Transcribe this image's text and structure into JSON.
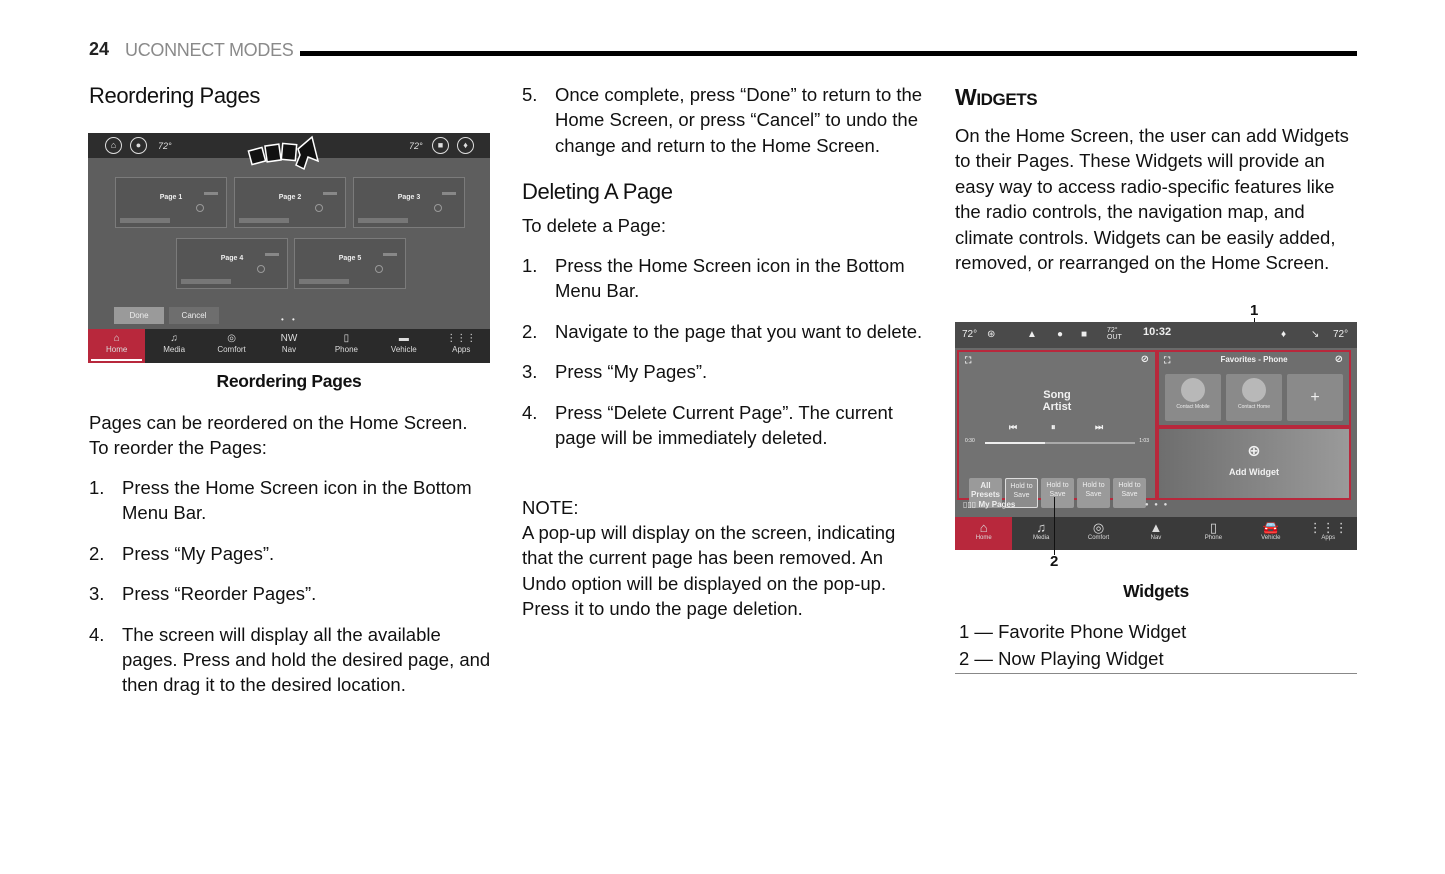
{
  "header": {
    "page_number": "24",
    "section_title": "UCONNECT MODES"
  },
  "left_column": {
    "heading": "Reordering Pages",
    "figure": {
      "caption": "Reordering Pages",
      "status_bar": {
        "temp_left": "72°",
        "temp_right": "72°"
      },
      "pages": [
        "Page 1",
        "Page 2",
        "Page 3",
        "Page 4",
        "Page 5"
      ],
      "buttons": {
        "done": "Done",
        "cancel": "Cancel"
      },
      "page_dots": "• •",
      "nav": [
        {
          "label": "Home",
          "icon": "⌂",
          "active": true
        },
        {
          "label": "Media",
          "icon": "♫",
          "active": false
        },
        {
          "label": "Comfort",
          "icon": "◎",
          "active": false
        },
        {
          "label": "Nav",
          "icon": "NW",
          "active": false
        },
        {
          "label": "Phone",
          "icon": "▯",
          "active": false
        },
        {
          "label": "Vehicle",
          "icon": "▬",
          "active": false
        },
        {
          "label": "Apps",
          "icon": "⋮⋮⋮",
          "active": false
        }
      ]
    },
    "intro": "Pages can be reordered on the Home Screen. To reorder the Pages:",
    "steps": [
      {
        "n": "1.",
        "text": "Press the Home Screen icon in the Bottom Menu Bar."
      },
      {
        "n": "2.",
        "text": "Press “My Pages”."
      },
      {
        "n": "3.",
        "text": "Press “Reorder Pages”."
      },
      {
        "n": "4.",
        "text": "The screen will display all the available pages. Press and hold the desired page, and then drag it to the desired location."
      }
    ]
  },
  "middle_column": {
    "continued_step": {
      "n": "5.",
      "text": "Once complete, press “Done” to return to the Home Screen, or press “Cancel” to undo the change and return to the Home Screen."
    },
    "heading": "Deleting A Page",
    "intro": "To delete a Page:",
    "steps": [
      {
        "n": "1.",
        "text": "Press the Home Screen icon in the Bottom Menu Bar."
      },
      {
        "n": "2.",
        "text": "Navigate to the page that you want to delete."
      },
      {
        "n": "3.",
        "text": "Press “My Pages”."
      },
      {
        "n": "4.",
        "text": "Press “Delete Current Page”. The current page will be immediately deleted."
      }
    ],
    "note_label": "NOTE:",
    "note_text": "A pop-up will display on the screen, indicating that the current page has been removed. An Undo option will be displayed on the pop-up. Press it to undo the page deletion."
  },
  "right_column": {
    "heading_cap": "W",
    "heading_rest": "IDGETS",
    "body": "On the Home Screen, the user can add Widgets to their Pages. These Widgets will provide an easy way to access radio-specific features like the radio controls, the navigation map, and climate controls. Widgets can be easily added, removed, or rearranged on the Home Screen.",
    "figure": {
      "caption": "Widgets",
      "callout_1": "1",
      "callout_2": "2",
      "status_bar": {
        "temp_left": "72°",
        "out_temp": "72°",
        "out_label": "OUT",
        "time": "10:32",
        "temp_right": "72°"
      },
      "now_playing": {
        "song": "Song",
        "artist": "Artist",
        "time_start": "0:30",
        "time_end": "1:03",
        "presets": [
          "All Presets",
          "Hold to Save",
          "Hold to Save",
          "Hold to Save",
          "Hold to Save"
        ]
      },
      "favorites": {
        "title": "Favorites - Phone",
        "contacts": [
          "Contact Mobile",
          "Contact Home"
        ],
        "add": "+"
      },
      "add_widget": "Add Widget",
      "my_pages": "My Pages",
      "nav": [
        {
          "label": "Home",
          "icon": "⌂",
          "active": true
        },
        {
          "label": "Media",
          "icon": "♫",
          "active": false
        },
        {
          "label": "Comfort",
          "icon": "◎",
          "active": false
        },
        {
          "label": "Nav",
          "icon": "▲",
          "active": false
        },
        {
          "label": "Phone",
          "icon": "▯",
          "active": false
        },
        {
          "label": "Vehicle",
          "icon": "🚘",
          "active": false
        },
        {
          "label": "Apps",
          "icon": "⋮⋮⋮",
          "active": false
        }
      ]
    },
    "legend": [
      "1 — Favorite Phone Widget",
      "2 — Now Playing Widget"
    ]
  },
  "colors": {
    "accent_red": "#b8283c",
    "rule": "#000000"
  }
}
